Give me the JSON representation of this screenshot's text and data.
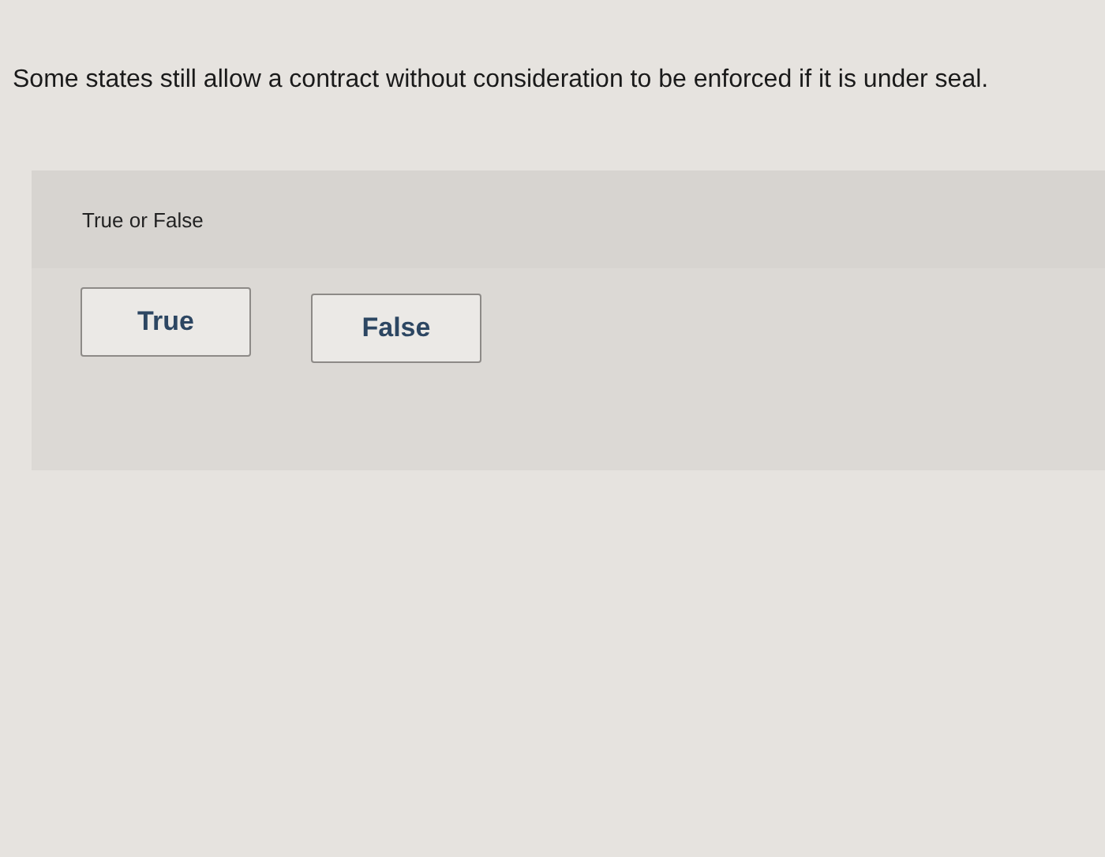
{
  "question": "Some states still allow a contract without consideration to be enforced if it is under seal.",
  "prompt": "True or False",
  "options": [
    {
      "label": "True",
      "selected": false
    },
    {
      "label": "False",
      "selected": false
    }
  ]
}
